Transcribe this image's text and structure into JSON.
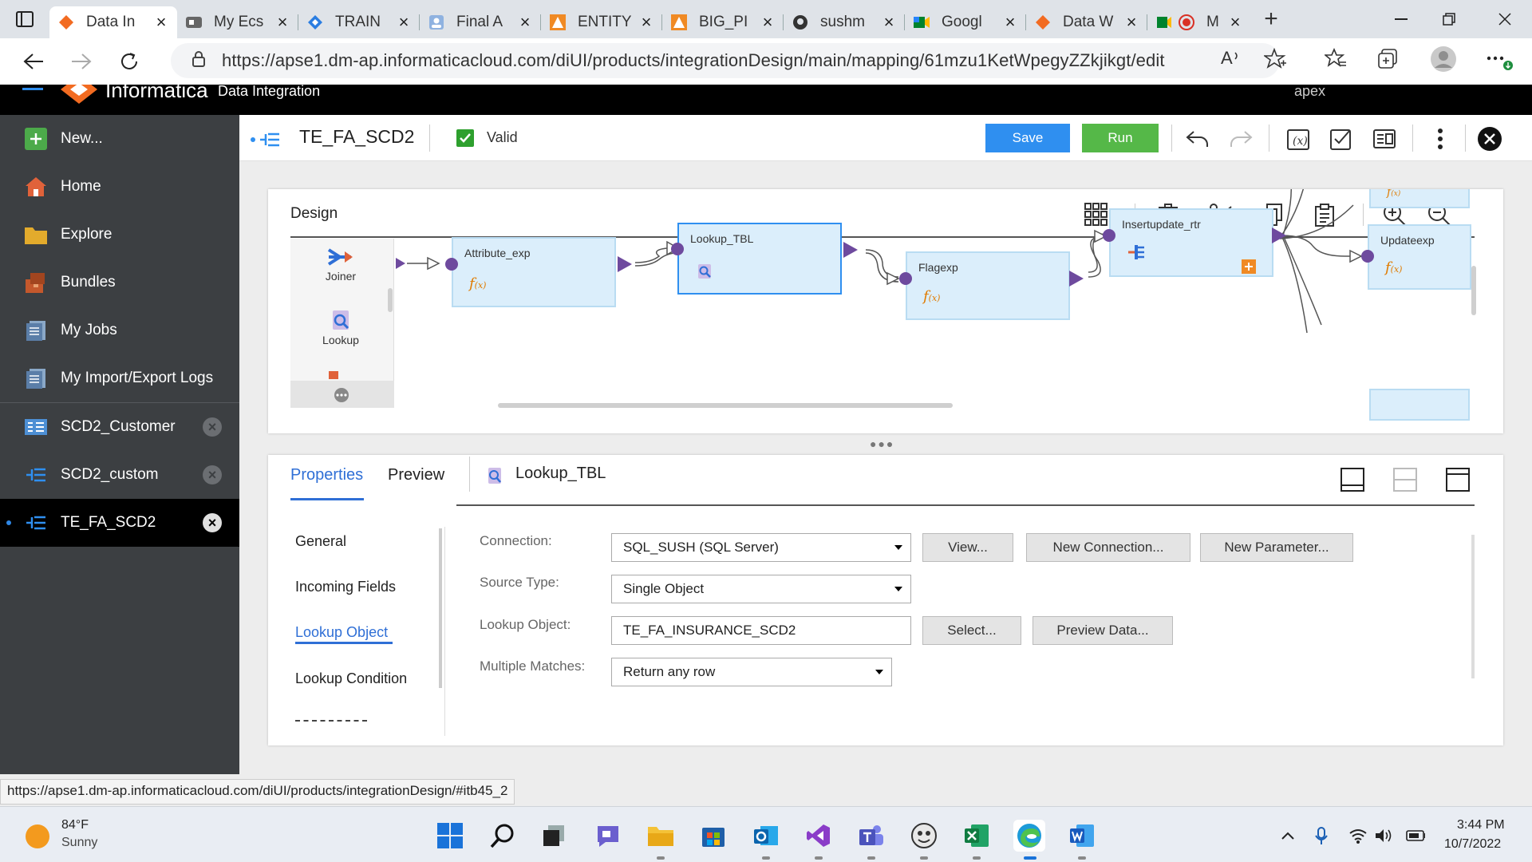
{
  "browser": {
    "tabs": [
      {
        "label": "Data In",
        "icon": "informatica-logo-icon",
        "active": true
      },
      {
        "label": "My Ecs",
        "icon": "video-icon"
      },
      {
        "label": "TRAIN",
        "icon": "diamond-icon"
      },
      {
        "label": "Final A",
        "icon": "contact-icon"
      },
      {
        "label": "ENTITY",
        "icon": "triangle-logo-icon"
      },
      {
        "label": "BIG_PI",
        "icon": "triangle-logo-icon"
      },
      {
        "label": "sushm",
        "icon": "github-icon"
      },
      {
        "label": "Googl",
        "icon": "google-meet-icon"
      },
      {
        "label": "Data W",
        "icon": "informatica-logo-icon"
      },
      {
        "label": "M",
        "icon": "record-icon"
      }
    ],
    "url": "https://apse1.dm-ap.informaticacloud.com/diUI/products/integrationDesign/main/mapping/61mzu1KetWpegyZZkjikgt/edit"
  },
  "app": {
    "brand": "Informatica",
    "service": "Data Integration",
    "user": "apex"
  },
  "nav": {
    "items": [
      {
        "label": "New...",
        "icon": "plus-icon"
      },
      {
        "label": "Home",
        "icon": "home-icon"
      },
      {
        "label": "Explore",
        "icon": "folder-icon"
      },
      {
        "label": "Bundles",
        "icon": "bundle-icon"
      },
      {
        "label": "My Jobs",
        "icon": "jobs-icon"
      },
      {
        "label": "My Import/Export Logs",
        "icon": "logs-icon"
      }
    ],
    "open_assets": [
      {
        "label": "SCD2_Customer"
      },
      {
        "label": "SCD2_custom"
      },
      {
        "label": "TE_FA_SCD2",
        "selected": true
      }
    ]
  },
  "toolbar": {
    "mapping_name": "TE_FA_SCD2",
    "status": "Valid",
    "save_label": "Save",
    "run_label": "Run"
  },
  "design": {
    "title": "Design",
    "palette": [
      {
        "label": "Joiner",
        "icon": "joiner-icon"
      },
      {
        "label": "Lookup",
        "icon": "lookup-icon"
      }
    ],
    "nodes": [
      {
        "label": "Attribute_exp",
        "icon": "fx-icon"
      },
      {
        "label": "Lookup_TBL",
        "icon": "lookup-icon",
        "selected": true
      },
      {
        "label": "Flagexp",
        "icon": "fx-icon"
      },
      {
        "label": "Insertupdate_rtr",
        "icon": "router-icon"
      },
      {
        "label": "Updateexp",
        "icon": "fx-icon"
      }
    ]
  },
  "props": {
    "tabs": {
      "properties": "Properties",
      "preview": "Preview"
    },
    "object": "Lookup_TBL",
    "sections": [
      "General",
      "Incoming Fields",
      "Lookup Object",
      "Lookup Condition"
    ],
    "active_section": "Lookup Object",
    "fields": {
      "connection_label": "Connection:",
      "connection_value": "SQL_SUSH (SQL Server)",
      "source_type_label": "Source Type:",
      "source_type_value": "Single Object",
      "lookup_object_label": "Lookup Object:",
      "lookup_object_value": "TE_FA_INSURANCE_SCD2",
      "multiple_matches_label": "Multiple Matches:",
      "multiple_matches_value": "Return any row"
    },
    "buttons": {
      "view": "View...",
      "new_connection": "New Connection...",
      "new_parameter": "New Parameter...",
      "select": "Select...",
      "preview_data": "Preview Data..."
    }
  },
  "status_url": "https://apse1.dm-ap.informaticacloud.com/diUI/products/integrationDesign/#itb45_2",
  "taskbar": {
    "weather_temp": "84°F",
    "weather_desc": "Sunny",
    "time": "3:44 PM",
    "date": "10/7/2022"
  },
  "colors": {
    "accent": "#2f8ff0",
    "run": "#55b848",
    "nav_bg": "#3c3f42",
    "node_bg": "#dbeefb",
    "port": "#6e4a9e"
  }
}
